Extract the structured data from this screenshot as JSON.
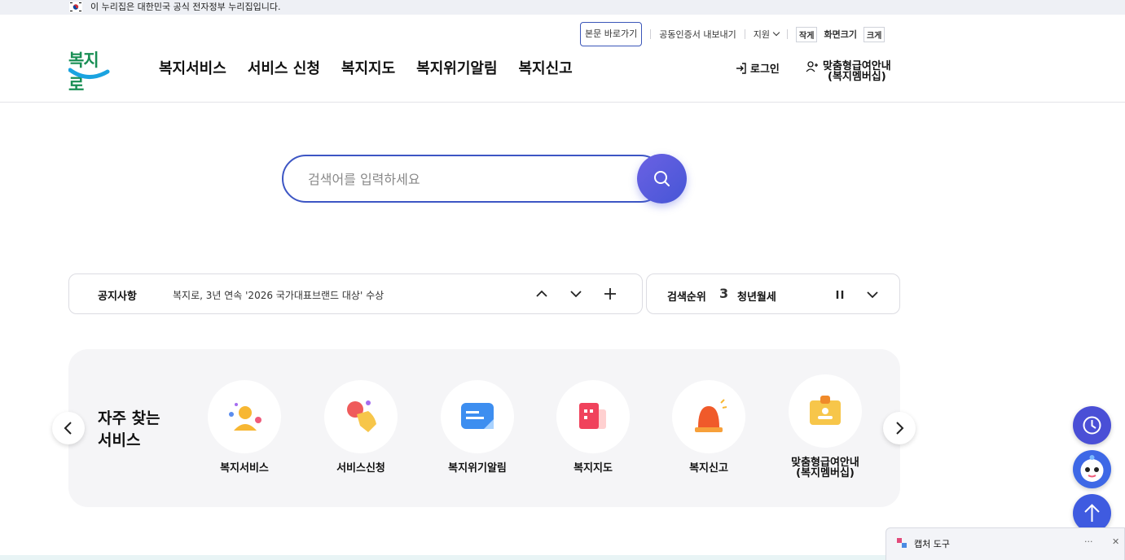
{
  "gov_banner": {
    "text": "이 누리집은 대한민국 공식 전자정부 누리집입니다."
  },
  "utility": {
    "skip_link": "본문 바로가기",
    "cert_export": "공동인증서 내보내기",
    "support": "지원",
    "font_small": "작게",
    "font_size": "화면크기",
    "font_large": "크게"
  },
  "logo": {
    "text": "복지로"
  },
  "nav": {
    "items": [
      "복지서비스",
      "서비스 신청",
      "복지지도",
      "복지위기알림",
      "복지신고"
    ],
    "login": "로그인",
    "member_line1": "맞춤형급여안내",
    "member_line2": "(복지멤버십)"
  },
  "search": {
    "placeholder": "검색어를 입력하세요"
  },
  "notice": {
    "label": "공지사항",
    "text": "복지로, 3년 연속 '2026 국가대표브랜드 대상' 수상"
  },
  "rank": {
    "label": "검색순위",
    "number": "3",
    "keyword": "청년월세"
  },
  "quick": {
    "title_line1": "자주 찾는",
    "title_line2": "서비스",
    "items": [
      {
        "label": "복지서비스"
      },
      {
        "label": "서비스신청"
      },
      {
        "label": "복지위기알림"
      },
      {
        "label": "복지지도"
      },
      {
        "label": "복지신고"
      },
      {
        "label_line1": "맞춤형급여안내",
        "label_line2": "(복지멤버십)"
      }
    ]
  },
  "capture_tool": {
    "title": "캡처 도구",
    "more": "···",
    "close": "✕"
  },
  "colors": {
    "primary": "#3d56c4",
    "accent": "#4a4fd6",
    "logo_green": "#1a8f55",
    "logo_blue": "#1aa3e0"
  }
}
